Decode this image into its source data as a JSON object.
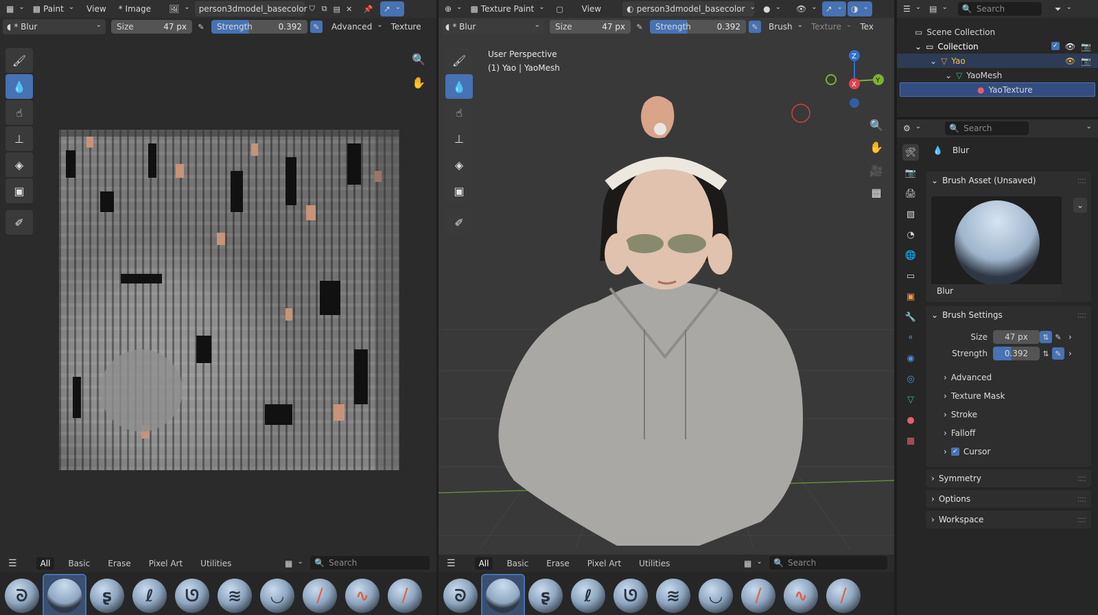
{
  "image_editor": {
    "mode_label": "Paint",
    "view_label": "View",
    "image_menu_label": "* Image",
    "image_name": "person3dmodel_basecolor",
    "brush_name": "* Blur",
    "size_label": "Size",
    "size_value": "47 px",
    "strength_label": "Strength",
    "strength_value": "0.392",
    "advanced_label": "Advanced",
    "texture_label": "Texture"
  },
  "viewport": {
    "mode_label": "Texture Paint",
    "view_label": "View",
    "image_name": "person3dmodel_basecolor",
    "brush_name": "* Blur",
    "size_label": "Size",
    "size_value": "47 px",
    "strength_label": "Strength",
    "strength_value": "0.392",
    "brush_menu_label": "Brush",
    "texture_menu_label": "Texture",
    "tex_trunc_label": "Tex",
    "overlay_line1": "User Perspective",
    "overlay_line2": "(1) Yao | YaoMesh",
    "gizmo_x": "X",
    "gizmo_y": "Y",
    "gizmo_z": "Z"
  },
  "asset_shelf": {
    "tabs": [
      "All",
      "Basic",
      "Erase",
      "Pixel Art",
      "Utilities"
    ],
    "search_placeholder": "Search"
  },
  "outliner": {
    "search_placeholder": "Search",
    "scene_collection": "Scene Collection",
    "collection": "Collection",
    "object": "Yao",
    "mesh": "YaoMesh",
    "material": "YaoTexture"
  },
  "properties": {
    "search_placeholder": "Search",
    "brush_title": "Blur",
    "brush_asset_header": "Brush Asset (Unsaved)",
    "preview_label": "Blur",
    "brush_settings_header": "Brush Settings",
    "size_label": "Size",
    "size_value": "47 px",
    "strength_label": "Strength",
    "strength_value": "0.392",
    "sub_items": [
      "Advanced",
      "Texture Mask",
      "Stroke",
      "Falloff",
      "Cursor"
    ],
    "sections": [
      "Symmetry",
      "Options",
      "Workspace"
    ]
  },
  "colors": {
    "accent": "#4772b3",
    "selected_row": "#334d80",
    "panel_bg": "#2b2b2b",
    "header_bg": "#303030"
  }
}
